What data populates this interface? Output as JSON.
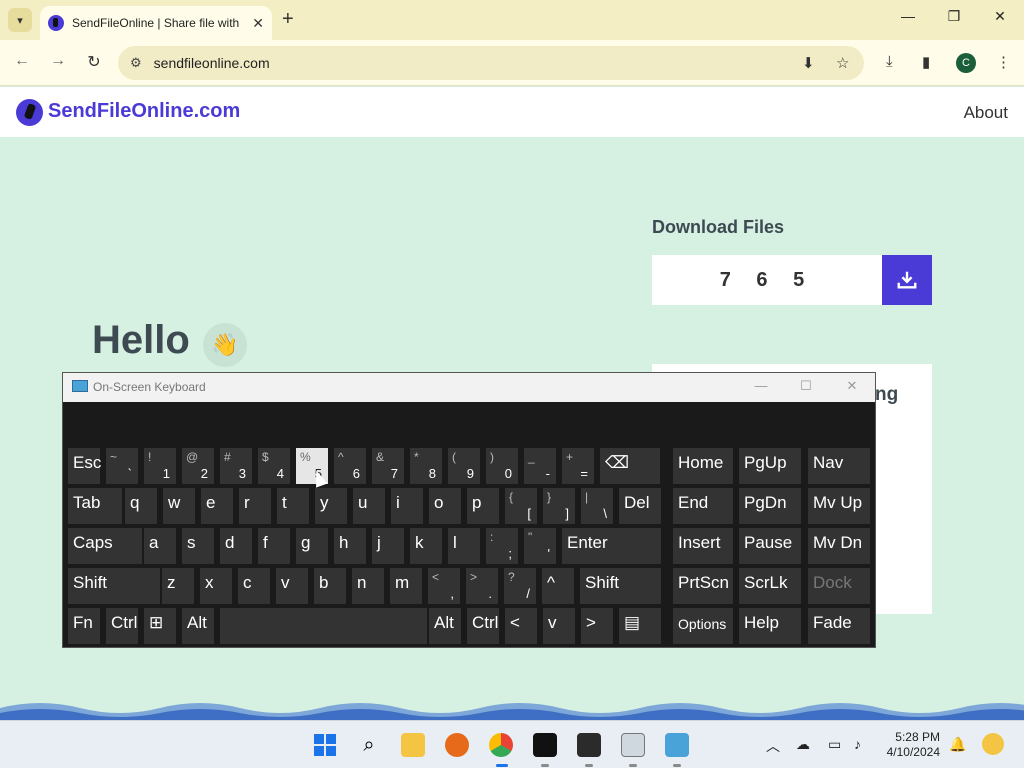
{
  "browser": {
    "tab_title": "SendFileOnline | Share file with",
    "url": "sendfileonline.com",
    "profile_initial": "C"
  },
  "site": {
    "logo_text": "SendFileOnline.com",
    "nav_about": "About",
    "download_title": "Download Files",
    "code": "765",
    "hello": "Hello",
    "card_text_partial": "ng",
    "brand_color": "#4b3bd6"
  },
  "osk": {
    "title": "On-Screen Keyboard",
    "rows": [
      [
        {
          "top": "",
          "bot": "",
          "label": "Esc"
        },
        {
          "top": "~",
          "bot": "`",
          "label": ""
        },
        {
          "top": "!",
          "bot": "1",
          "label": ""
        },
        {
          "top": "@",
          "bot": "2",
          "label": ""
        },
        {
          "top": "#",
          "bot": "3",
          "label": ""
        },
        {
          "top": "$",
          "bot": "4",
          "label": ""
        },
        {
          "top": "%",
          "bot": "5",
          "label": "",
          "pressed": true
        },
        {
          "top": "^",
          "bot": "6",
          "label": ""
        },
        {
          "top": "&",
          "bot": "7",
          "label": ""
        },
        {
          "top": "*",
          "bot": "8",
          "label": ""
        },
        {
          "top": "(",
          "bot": "9",
          "label": ""
        },
        {
          "top": ")",
          "bot": "0",
          "label": ""
        },
        {
          "top": "_",
          "bot": "-",
          "label": ""
        },
        {
          "top": "+",
          "bot": "=",
          "label": ""
        },
        {
          "top": "",
          "bot": "",
          "label": "⌫"
        }
      ],
      [
        {
          "label": "Tab"
        },
        {
          "label": "q"
        },
        {
          "label": "w"
        },
        {
          "label": "e"
        },
        {
          "label": "r"
        },
        {
          "label": "t"
        },
        {
          "label": "y"
        },
        {
          "label": "u"
        },
        {
          "label": "i"
        },
        {
          "label": "o"
        },
        {
          "label": "p"
        },
        {
          "top": "{",
          "bot": "[",
          "label": ""
        },
        {
          "top": "}",
          "bot": "]",
          "label": ""
        },
        {
          "top": "|",
          "bot": "\\",
          "label": ""
        },
        {
          "label": "Del"
        }
      ],
      [
        {
          "label": "Caps"
        },
        {
          "label": "a"
        },
        {
          "label": "s"
        },
        {
          "label": "d"
        },
        {
          "label": "f"
        },
        {
          "label": "g"
        },
        {
          "label": "h"
        },
        {
          "label": "j"
        },
        {
          "label": "k"
        },
        {
          "label": "l"
        },
        {
          "top": ":",
          "bot": ";",
          "label": ""
        },
        {
          "top": "\"",
          "bot": "'",
          "label": ""
        },
        {
          "label": "Enter"
        }
      ],
      [
        {
          "label": "Shift"
        },
        {
          "label": "z"
        },
        {
          "label": "x"
        },
        {
          "label": "c"
        },
        {
          "label": "v"
        },
        {
          "label": "b"
        },
        {
          "label": "n"
        },
        {
          "label": "m"
        },
        {
          "top": "<",
          "bot": ",",
          "label": ""
        },
        {
          "top": ">",
          "bot": ".",
          "label": ""
        },
        {
          "top": "?",
          "bot": "/",
          "label": ""
        },
        {
          "label": "^"
        },
        {
          "label": "Shift"
        }
      ],
      [
        {
          "label": "Fn"
        },
        {
          "label": "Ctrl"
        },
        {
          "label": "⊞"
        },
        {
          "label": "Alt"
        },
        {
          "label": ""
        },
        {
          "label": "Alt"
        },
        {
          "label": "Ctrl"
        },
        {
          "label": "<"
        },
        {
          "label": "v"
        },
        {
          "label": ">"
        },
        {
          "label": "▤"
        }
      ]
    ],
    "side": [
      [
        "Home",
        "PgUp",
        "Nav"
      ],
      [
        "End",
        "PgDn",
        "Mv Up"
      ],
      [
        "Insert",
        "Pause",
        "Mv Dn"
      ],
      [
        "PrtScn",
        "ScrLk",
        "Dock"
      ],
      [
        "Options",
        "Help",
        "Fade"
      ]
    ]
  },
  "taskbar": {
    "time": "5:28 PM",
    "date": "4/10/2024"
  }
}
